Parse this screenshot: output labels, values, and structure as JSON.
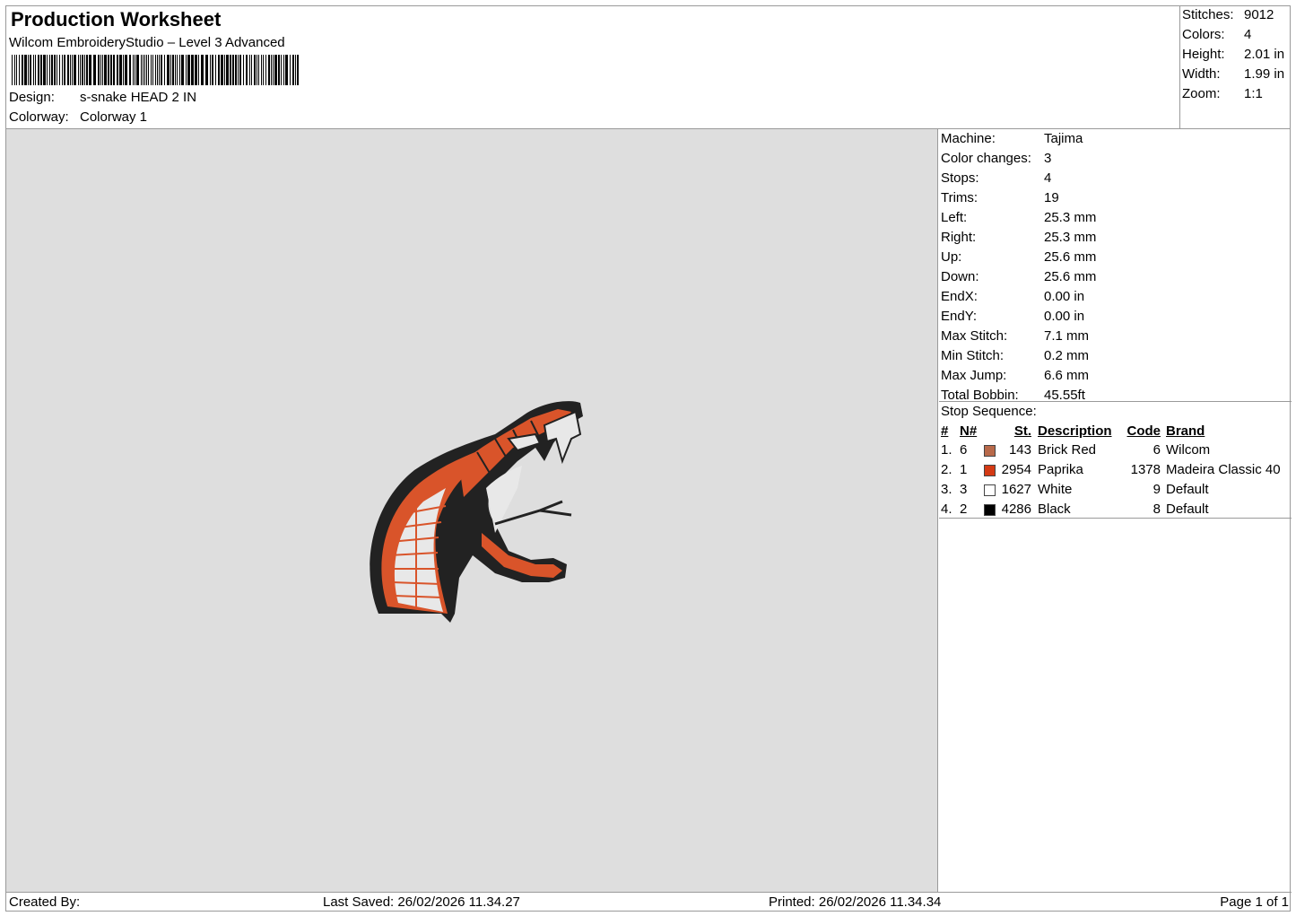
{
  "header": {
    "title": "Production Worksheet",
    "subtitle": "Wilcom EmbroideryStudio – Level 3 Advanced",
    "design_label": "Design:",
    "design_value": "s-snake HEAD 2 IN",
    "colorway_label": "Colorway:",
    "colorway_value": "Colorway 1"
  },
  "stats": [
    {
      "label": "Stitches:",
      "value": "9012"
    },
    {
      "label": "Colors:",
      "value": "4"
    },
    {
      "label": "Height:",
      "value": "2.01 in"
    },
    {
      "label": "Width:",
      "value": "1.99 in"
    },
    {
      "label": "Zoom:",
      "value": "1:1"
    }
  ],
  "machine_info": [
    {
      "label": "Machine:",
      "value": "Tajima"
    },
    {
      "label": "Color changes:",
      "value": "3"
    },
    {
      "label": "Stops:",
      "value": "4"
    },
    {
      "label": "Trims:",
      "value": "19"
    },
    {
      "label": "Left:",
      "value": "25.3 mm"
    },
    {
      "label": "Right:",
      "value": "25.3 mm"
    },
    {
      "label": "Up:",
      "value": "25.6 mm"
    },
    {
      "label": "Down:",
      "value": "25.6 mm"
    },
    {
      "label": "EndX:",
      "value": "0.00 in"
    },
    {
      "label": "EndY:",
      "value": "0.00 in"
    },
    {
      "label": "Max Stitch:",
      "value": "7.1 mm"
    },
    {
      "label": "Min Stitch:",
      "value": "0.2 mm"
    },
    {
      "label": "Max Jump:",
      "value": "6.6 mm"
    },
    {
      "label": "Total Bobbin:",
      "value": "45.55ft"
    }
  ],
  "stop_sequence": {
    "heading": "Stop Sequence:",
    "columns": {
      "num": "#",
      "n": "N#",
      "st": "St.",
      "description": "Description",
      "code": "Code",
      "brand": "Brand"
    },
    "rows": [
      {
        "num": "1.",
        "n": "6",
        "color": "#b8694a",
        "st": "143",
        "description": "Brick Red",
        "code": "6",
        "brand": "Wilcom"
      },
      {
        "num": "2.",
        "n": "1",
        "color": "#d43a14",
        "st": "2954",
        "description": "Paprika",
        "code": "1378",
        "brand": "Madeira Classic 40"
      },
      {
        "num": "3.",
        "n": "3",
        "color": "#ffffff",
        "st": "1627",
        "description": "White",
        "code": "9",
        "brand": "Default"
      },
      {
        "num": "4.",
        "n": "2",
        "color": "#000000",
        "st": "4286",
        "description": "Black",
        "code": "8",
        "brand": "Default"
      }
    ]
  },
  "footer": {
    "created_by": "Created By:",
    "last_saved": "Last Saved: 26/02/2026 11.34.27",
    "printed": "Printed: 26/02/2026 11.34.34",
    "page": "Page 1 of 1"
  },
  "preview": {
    "background": "#dedede",
    "icon": "snake-head-embroidery"
  }
}
